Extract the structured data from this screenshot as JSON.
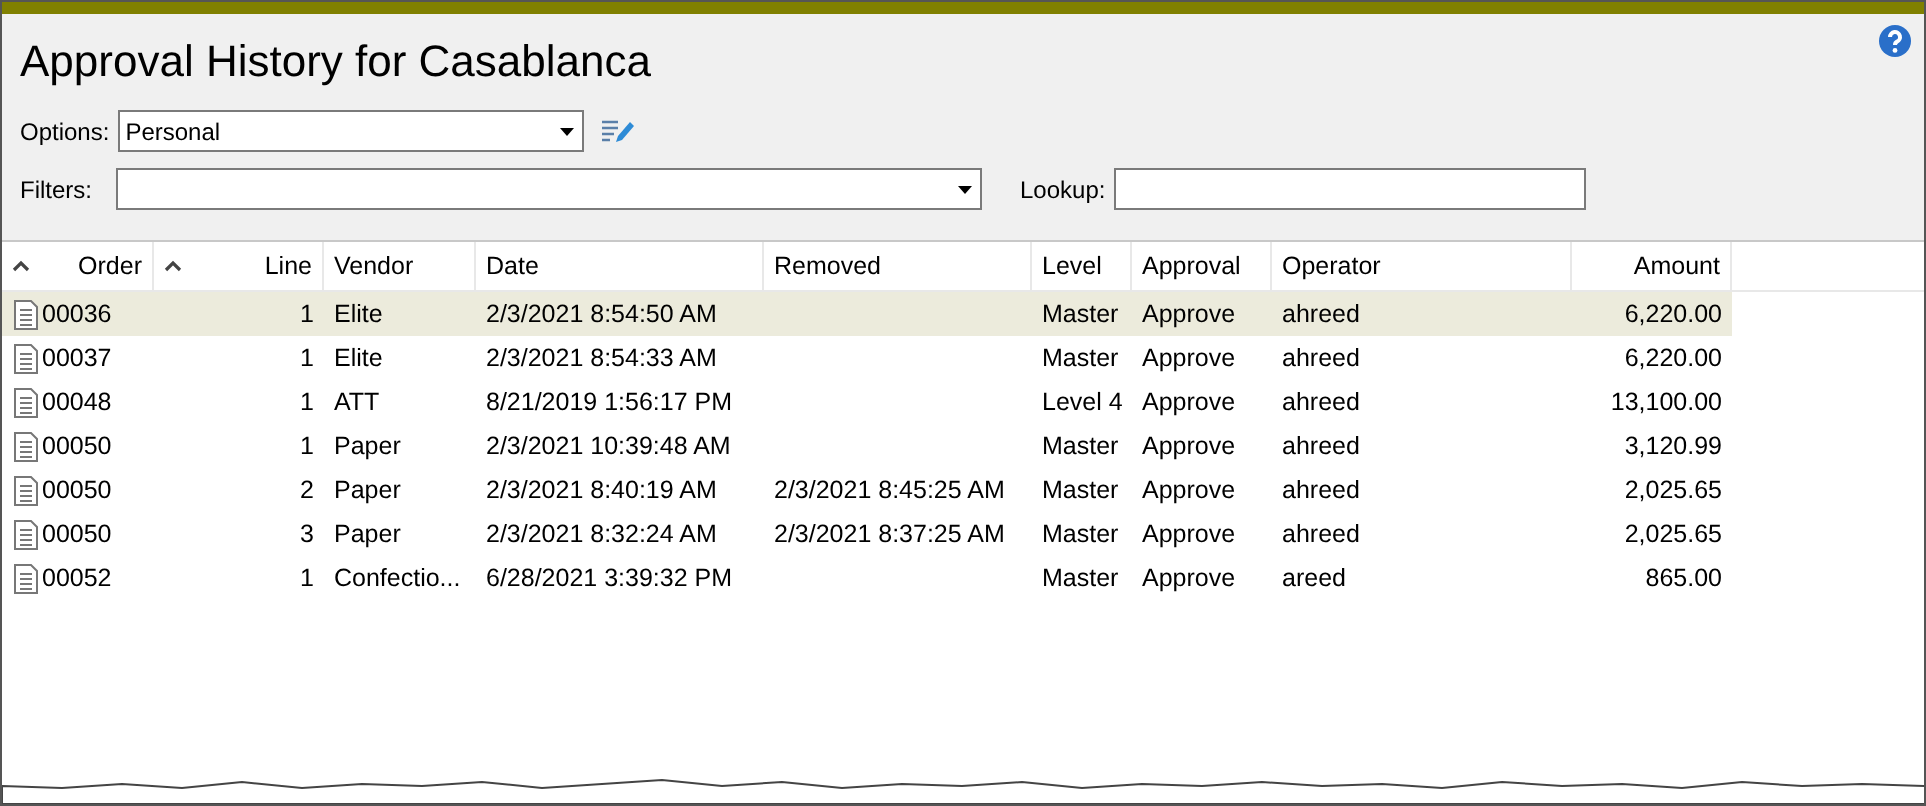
{
  "title": "Approval History for Casablanca",
  "options": {
    "label": "Options:",
    "value": "Personal"
  },
  "filters": {
    "label": "Filters:"
  },
  "lookup": {
    "label": "Lookup:"
  },
  "table": {
    "columns": [
      {
        "label": "Order",
        "sorted": true
      },
      {
        "label": "Line",
        "sorted": true
      },
      {
        "label": "Vendor",
        "sorted": false
      },
      {
        "label": "Date",
        "sorted": false
      },
      {
        "label": "Removed",
        "sorted": false
      },
      {
        "label": "Level",
        "sorted": false
      },
      {
        "label": "Approval",
        "sorted": false
      },
      {
        "label": "Operator",
        "sorted": false
      },
      {
        "label": "Amount",
        "sorted": false
      }
    ],
    "rows": [
      {
        "selected": true,
        "cells": [
          "00036",
          "1",
          "Elite",
          "2/3/2021 8:54:50 AM",
          "",
          "Master",
          "Approve",
          "ahreed",
          "6,220.00"
        ]
      },
      {
        "selected": false,
        "cells": [
          "00037",
          "1",
          "Elite",
          "2/3/2021 8:54:33 AM",
          "",
          "Master",
          "Approve",
          "ahreed",
          "6,220.00"
        ]
      },
      {
        "selected": false,
        "cells": [
          "00048",
          "1",
          "ATT",
          "8/21/2019 1:56:17 PM",
          "",
          "Level 4",
          "Approve",
          "ahreed",
          "13,100.00"
        ]
      },
      {
        "selected": false,
        "cells": [
          "00050",
          "1",
          "Paper",
          "2/3/2021 10:39:48 AM",
          "",
          "Master",
          "Approve",
          "ahreed",
          "3,120.99"
        ]
      },
      {
        "selected": false,
        "cells": [
          "00050",
          "2",
          "Paper",
          "2/3/2021 8:40:19 AM",
          "2/3/2021 8:45:25 AM",
          "Master",
          "Approve",
          "ahreed",
          "2,025.65"
        ]
      },
      {
        "selected": false,
        "cells": [
          "00050",
          "3",
          "Paper",
          "2/3/2021 8:32:24 AM",
          "2/3/2021 8:37:25 AM",
          "Master",
          "Approve",
          "ahreed",
          "2,025.65"
        ]
      },
      {
        "selected": false,
        "cells": [
          "00052",
          "1",
          "Confectio...",
          "6/28/2021 3:39:32 PM",
          "",
          "Master",
          "Approve",
          "areed",
          "865.00"
        ]
      }
    ]
  }
}
